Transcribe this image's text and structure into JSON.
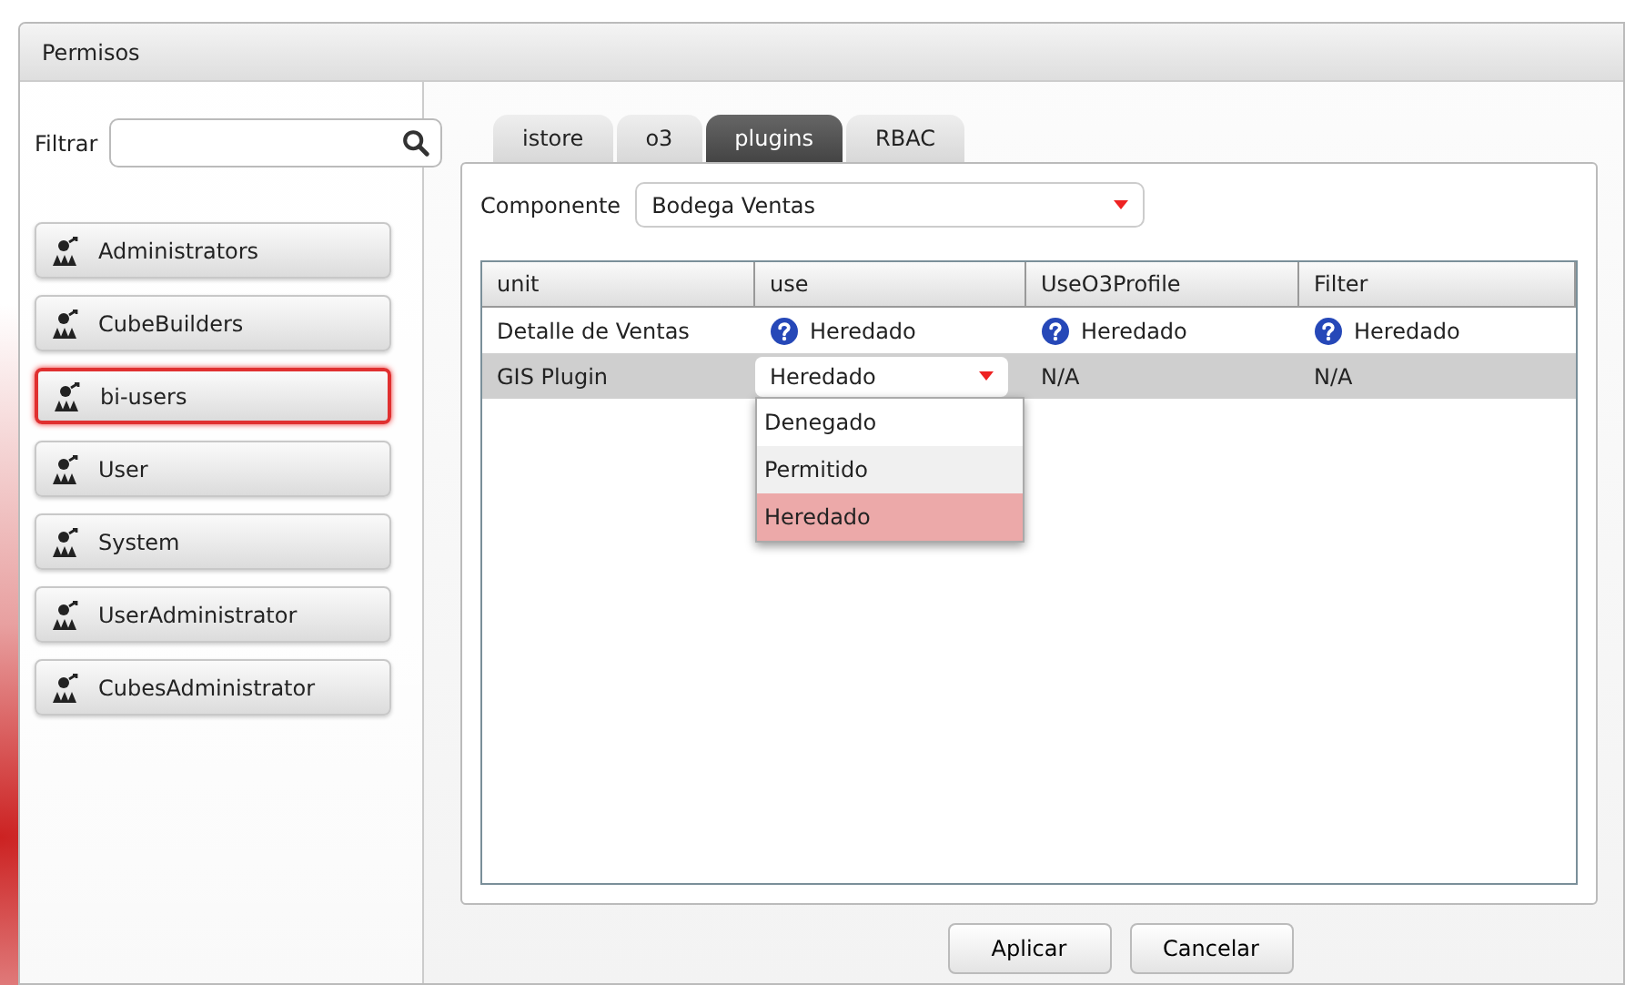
{
  "window": {
    "title": "Permisos"
  },
  "filter": {
    "label": "Filtrar"
  },
  "groups": [
    {
      "label": "Administrators",
      "selected": false
    },
    {
      "label": "CubeBuilders",
      "selected": false
    },
    {
      "label": "bi-users",
      "selected": true
    },
    {
      "label": "User",
      "selected": false
    },
    {
      "label": "System",
      "selected": false
    },
    {
      "label": "UserAdministrator",
      "selected": false
    },
    {
      "label": "CubesAdministrator",
      "selected": false
    }
  ],
  "tabs": [
    {
      "label": "istore",
      "selected": false
    },
    {
      "label": "o3",
      "selected": false
    },
    {
      "label": "plugins",
      "selected": true
    },
    {
      "label": "RBAC",
      "selected": false
    }
  ],
  "component": {
    "label": "Componente",
    "value": "Bodega Ventas"
  },
  "table": {
    "columns": [
      "unit",
      "use",
      "UseO3Profile",
      "Filter"
    ],
    "rows": [
      {
        "selected": false,
        "cells": [
          {
            "kind": "text",
            "text": "Detalle de Ventas"
          },
          {
            "kind": "status",
            "text": "Heredado"
          },
          {
            "kind": "status",
            "text": "Heredado"
          },
          {
            "kind": "status",
            "text": "Heredado"
          }
        ]
      },
      {
        "selected": true,
        "cells": [
          {
            "kind": "text",
            "text": "GIS Plugin"
          },
          {
            "kind": "select",
            "text": "Heredado",
            "options": [
              {
                "label": "Denegado",
                "selected": false
              },
              {
                "label": "Permitido",
                "selected": false
              },
              {
                "label": "Heredado",
                "selected": true
              }
            ]
          },
          {
            "kind": "text",
            "text": "N/A"
          },
          {
            "kind": "text",
            "text": "N/A"
          }
        ]
      }
    ]
  },
  "buttons": [
    "Aplicar",
    "Cancelar"
  ]
}
